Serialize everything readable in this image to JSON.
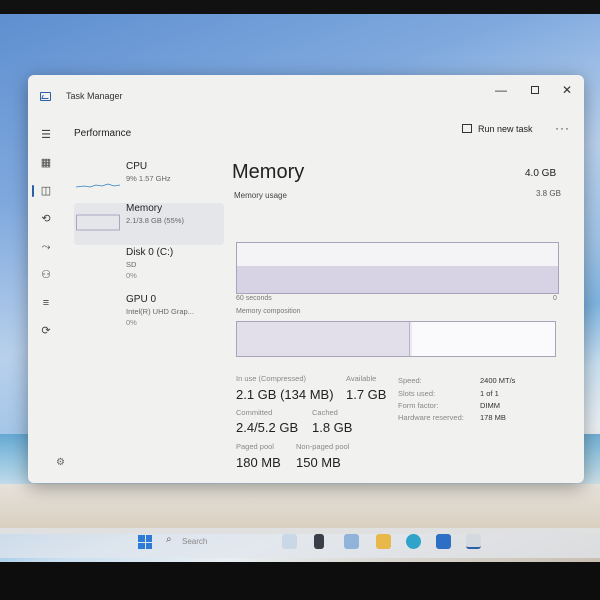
{
  "window": {
    "title": "Task Manager",
    "controls": {
      "minimize": "—",
      "close": "✕"
    }
  },
  "header": {
    "page_title": "Performance",
    "run_task_label": "Run new task",
    "more_label": "···"
  },
  "resources": [
    {
      "name": "CPU",
      "sub": "9% 1.57 GHz",
      "sub2": ""
    },
    {
      "name": "Memory",
      "sub": "2.1/3.8 GB (55%)",
      "sub2": ""
    },
    {
      "name": "Disk 0 (C:)",
      "sub": "SD",
      "sub2": "0%"
    },
    {
      "name": "GPU 0",
      "sub": "Intel(R) UHD Grap...",
      "sub2": "0%"
    }
  ],
  "detail": {
    "title": "Memory",
    "total": "4.0 GB",
    "usage_label": "Memory usage",
    "usage_max": "3.8 GB",
    "axis_left": "60 seconds",
    "axis_right": "0",
    "composition_label": "Memory composition",
    "usage_fraction": 0.55,
    "composition_in_use_fraction": 0.54,
    "composition_modified_fraction": 0.01
  },
  "stats": {
    "in_use_label": "In use (Compressed)",
    "in_use_value": "2.1 GB (134 MB)",
    "available_label": "Available",
    "available_value": "1.7 GB",
    "committed_label": "Committed",
    "committed_value": "2.4/5.2 GB",
    "cached_label": "Cached",
    "cached_value": "1.8 GB",
    "paged_pool_label": "Paged pool",
    "paged_pool_value": "180 MB",
    "non_paged_pool_label": "Non-paged pool",
    "non_paged_pool_value": "150 MB"
  },
  "hardware": [
    {
      "key": "Speed:",
      "value": "2400 MT/s"
    },
    {
      "key": "Slots used:",
      "value": "1 of 1"
    },
    {
      "key": "Form factor:",
      "value": "DIMM"
    },
    {
      "key": "Hardware reserved:",
      "value": "178 MB"
    }
  ],
  "taskbar": {
    "search_label": "Search"
  },
  "icons": {
    "rail": [
      "hamburger-icon",
      "processes-icon",
      "performance-icon",
      "app-history-icon",
      "startup-apps-icon",
      "users-icon",
      "details-icon",
      "services-icon",
      "settings-icon"
    ]
  },
  "colors": {
    "accent": "#2d5fa8",
    "graph_border": "#a7a3b8",
    "window_bg": "#f1f1ef"
  }
}
